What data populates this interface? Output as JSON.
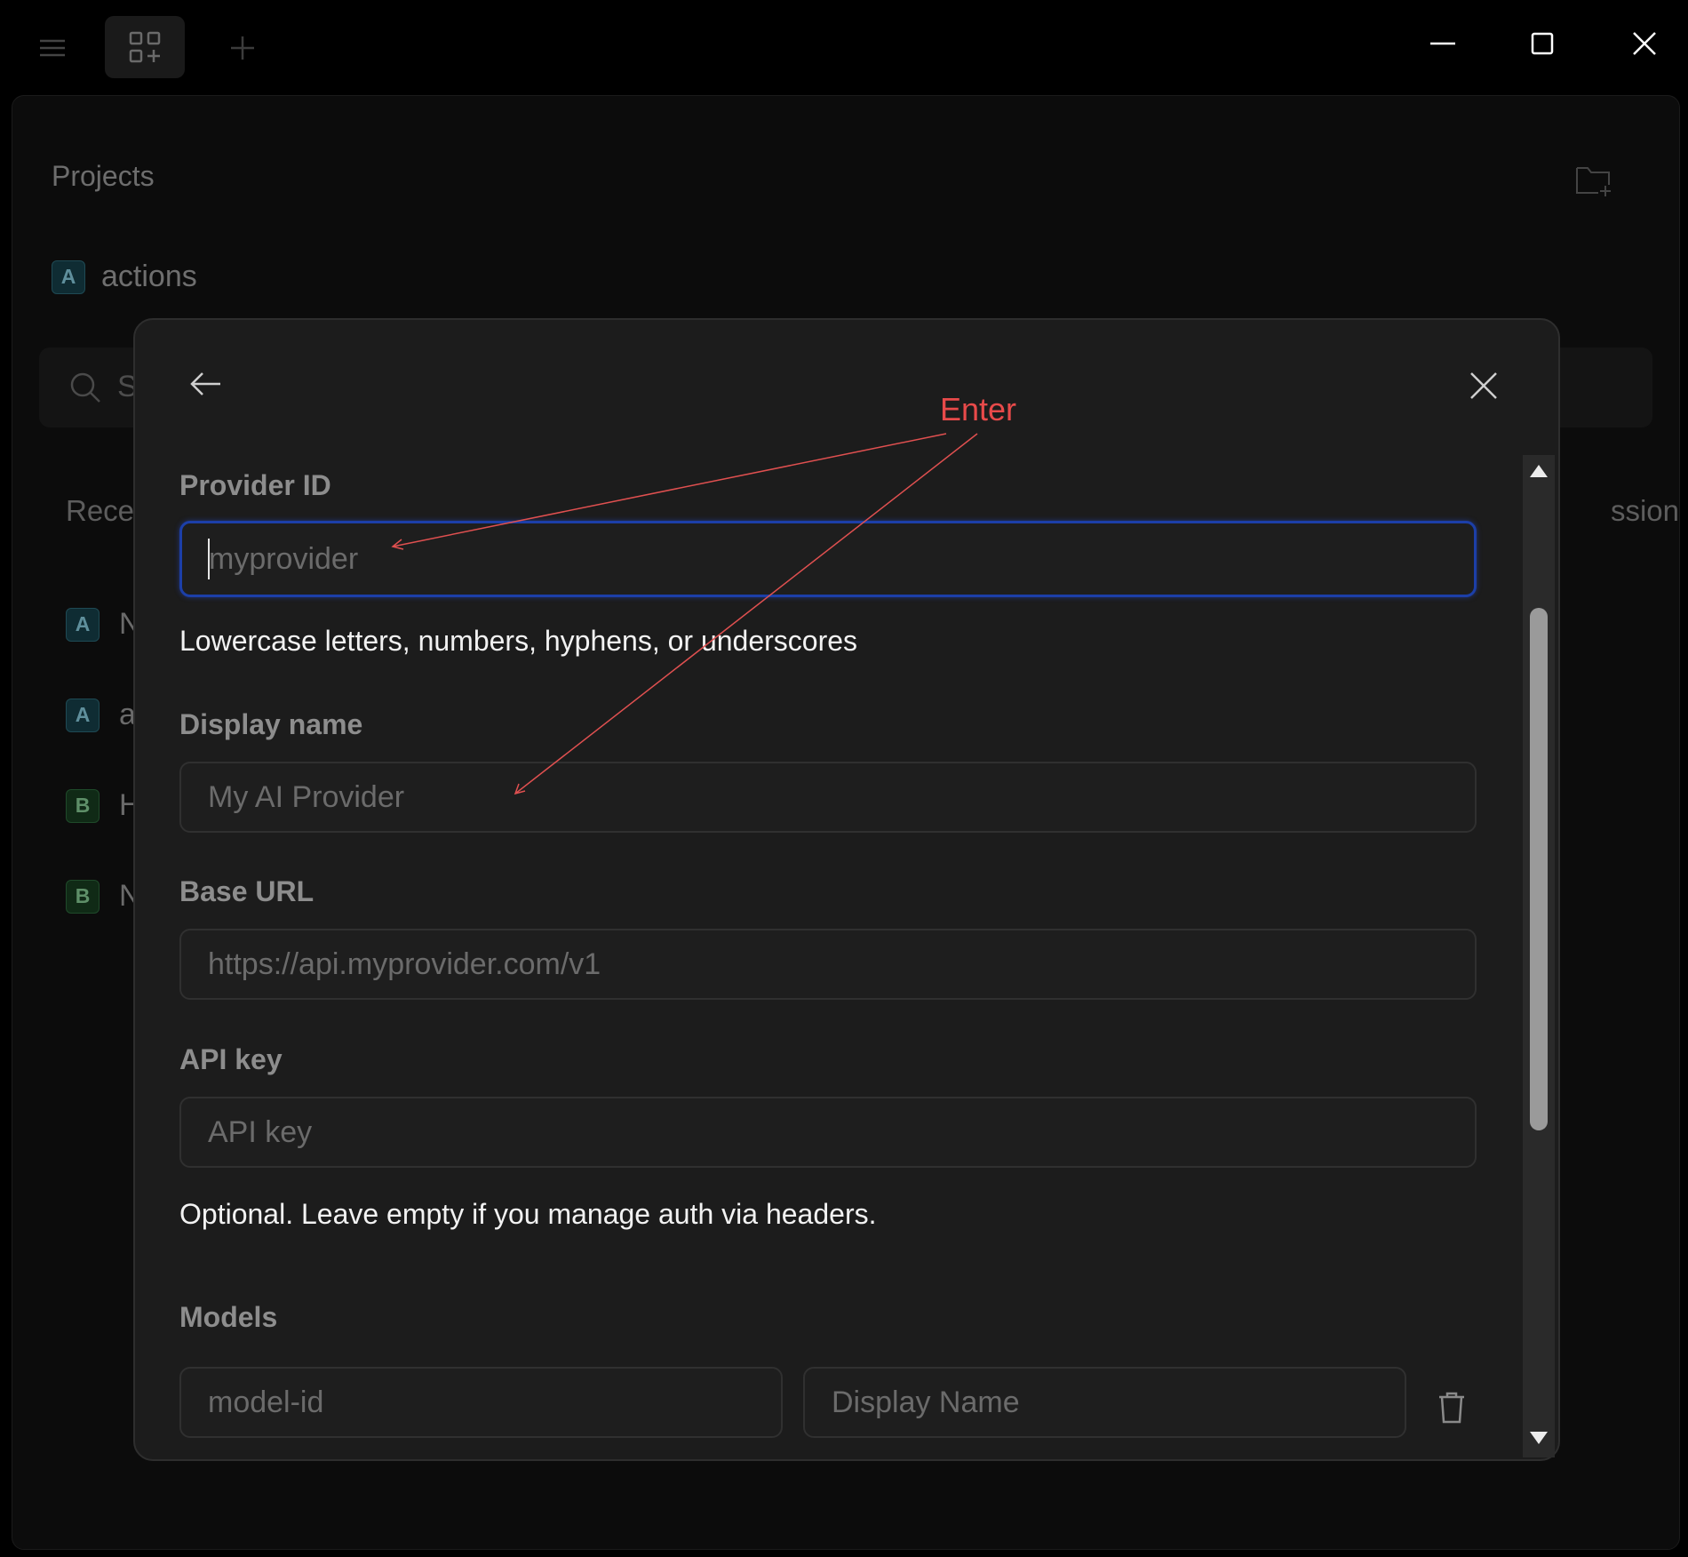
{
  "titlebar": {
    "menu_icon": "hamburger-icon",
    "grid_icon": "grid-add-icon",
    "plus_icon": "plus-icon",
    "window_controls": [
      "minimize-icon",
      "maximize-icon",
      "close-icon"
    ]
  },
  "background": {
    "projects_title": "Projects",
    "project": {
      "badge": "A",
      "name": "actions"
    },
    "search_placeholder_visible": "S",
    "recent_label_visible": "Rece",
    "session_label_visible": "ssion",
    "recent_items": [
      {
        "badge": "A",
        "text": "N"
      },
      {
        "badge": "A",
        "text": "a"
      },
      {
        "badge": "B",
        "text": "H"
      },
      {
        "badge": "B",
        "text": "N"
      }
    ]
  },
  "modal": {
    "provider_id": {
      "label": "Provider ID",
      "placeholder": "myprovider",
      "value": "",
      "help": "Lowercase letters, numbers, hyphens, or underscores"
    },
    "display_name": {
      "label": "Display name",
      "placeholder": "My AI Provider",
      "value": ""
    },
    "base_url": {
      "label": "Base URL",
      "placeholder": "https://api.myprovider.com/v1",
      "value": ""
    },
    "api_key": {
      "label": "API key",
      "placeholder": "API key",
      "value": "",
      "help": "Optional. Leave empty if you manage auth via headers."
    },
    "models": {
      "label": "Models",
      "model_id_placeholder": "model-id",
      "display_name_placeholder": "Display Name"
    }
  },
  "annotation": {
    "text": "Enter",
    "color": "#e84a4a"
  },
  "colors": {
    "focus_border": "#1c3fa8",
    "modal_bg": "#1c1c1c",
    "page_bg": "#000000"
  }
}
